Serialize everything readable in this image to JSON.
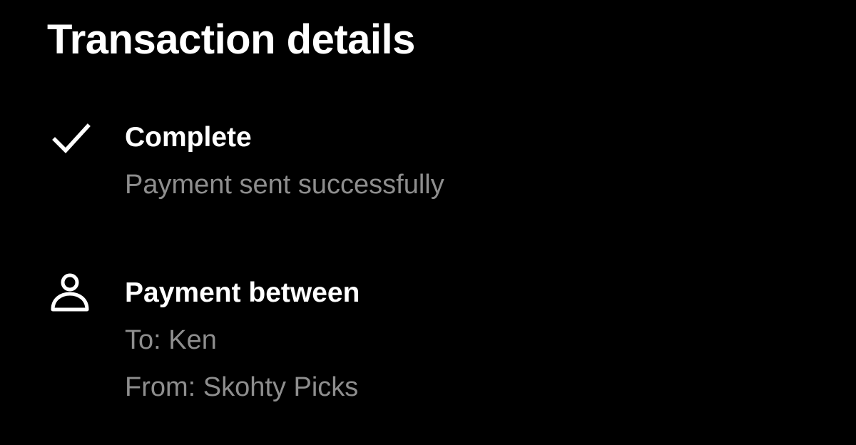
{
  "header": {
    "title": "Transaction details"
  },
  "status": {
    "icon": "checkmark-icon",
    "title": "Complete",
    "description": "Payment sent successfully"
  },
  "payment_between": {
    "icon": "person-icon",
    "title": "Payment between",
    "to": "To: Ken",
    "from": "From: Skohty Picks"
  },
  "colors": {
    "background": "#000000",
    "primary_text": "#ffffff",
    "secondary_text": "#8e8e8e"
  }
}
